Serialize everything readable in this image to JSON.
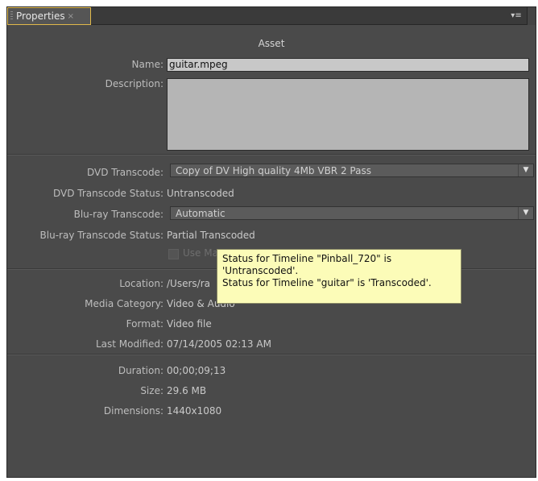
{
  "tab": {
    "label": "Properties",
    "close": "×",
    "menu_icon": "panel-menu-icon"
  },
  "asset": {
    "header": "Asset",
    "name_label": "Name:",
    "name_value": "guitar.mpeg",
    "description_label": "Description:"
  },
  "transcode": {
    "dvd_label": "DVD Transcode:",
    "dvd_value": "Copy of DV High quality 4Mb VBR 2 Pass",
    "dvd_status_label": "DVD Transcode Status:",
    "dvd_status_value": "Untranscoded",
    "bluray_label": "Blu-ray Transcode:",
    "bluray_value": "Automatic",
    "bluray_status_label": "Blu-ray Transcode Status:",
    "bluray_status_value": "Partial Transcoded",
    "use_checkbox_label": "Use Ma"
  },
  "file": {
    "location_label": "Location:",
    "location_value": "/Users/ra",
    "media_category_label": "Media Category:",
    "media_category_value": "Video & Audio",
    "format_label": "Format:",
    "format_value": "Video file",
    "last_modified_label": "Last Modified:",
    "last_modified_value": "07/14/2005 02:13 AM"
  },
  "media": {
    "duration_label": "Duration:",
    "duration_value": "00;00;09;13",
    "size_label": "Size:",
    "size_value": "29.6 MB",
    "dimensions_label": "Dimensions:",
    "dimensions_value": "1440x1080"
  },
  "tooltip": {
    "text": "Status for Timeline \"Pinball_720\" is\n'Untranscoded'.\nStatus for Timeline \"guitar\" is 'Transcoded'."
  },
  "colors": {
    "panel_bg": "#4a4a4a",
    "tab_highlight": "#e0b84a",
    "tooltip_bg": "#fcfcb8"
  }
}
